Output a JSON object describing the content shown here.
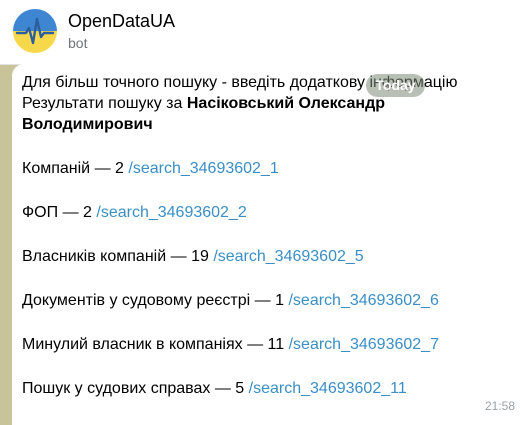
{
  "chat": {
    "title": "OpenDataUA",
    "subtitle": "bot"
  },
  "floating_date": "Today",
  "message": {
    "intro": "Для більш точного пошуку - введіть додаткову інформацію",
    "results_prefix": "Результати пошуку за ",
    "query_name_part1": "Насіковський Олександр",
    "query_name_part2": "Володимирович",
    "items": [
      {
        "label": "Компаній",
        "count": "2",
        "link": "/search_34693602_1"
      },
      {
        "label": "ФОП",
        "count": "2",
        "link": "/search_34693602_2"
      },
      {
        "label": "Власників компаній",
        "count": "19",
        "link": "/search_34693602_5"
      },
      {
        "label": "Документів у судовому реєстрі",
        "count": "1",
        "link": "/search_34693602_6"
      },
      {
        "label": "Минулий власник в компаніях",
        "count": "11",
        "link": "/search_34693602_7"
      },
      {
        "label": "Пошук у судових справах",
        "count": "5",
        "link": "/search_34693602_11"
      }
    ],
    "separator": "—",
    "time": "21:58"
  },
  "avatar": {
    "top_color": "#3E86D1",
    "bottom_color": "#F7D84A",
    "pulse_color": "#2C5F9E",
    "icon": "ukraine-pulse-logo"
  }
}
